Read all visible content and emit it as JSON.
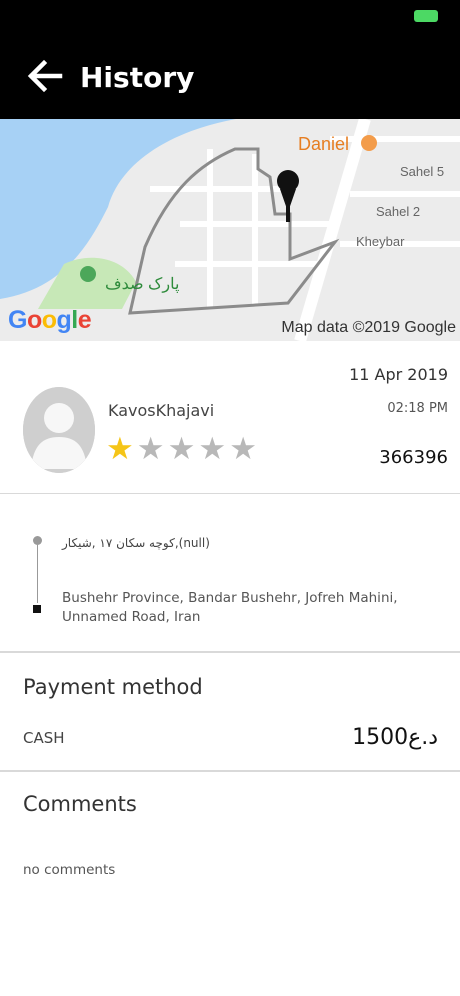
{
  "status_bar": {
    "battery_color": "#4cd964"
  },
  "header": {
    "title": "History",
    "back_icon": "arrow-left-icon"
  },
  "map": {
    "attribution": "Map data ©2019 Google",
    "logo_text": "Google",
    "labels": {
      "poi": "Daniel",
      "street1": "Sahel 5",
      "street2": "Sahel 2",
      "street3": "Kheybar",
      "park": "پارک صدف"
    }
  },
  "trip": {
    "driver_name": "KavosKhajavi",
    "rating": 1,
    "max_rating": 5,
    "date": "11 Apr 2019",
    "time": "02:18 PM",
    "code": "366396"
  },
  "route": {
    "origin": "کوچه سکان ۱۷ ,شیکار,(null)",
    "destination": "Bushehr Province, Bandar Bushehr, Jofreh Mahini, Unnamed Road, Iran"
  },
  "payment": {
    "title": "Payment method",
    "method": "CASH",
    "amount": "1500د.ع"
  },
  "comments": {
    "title": "Comments",
    "text": "no comments"
  }
}
